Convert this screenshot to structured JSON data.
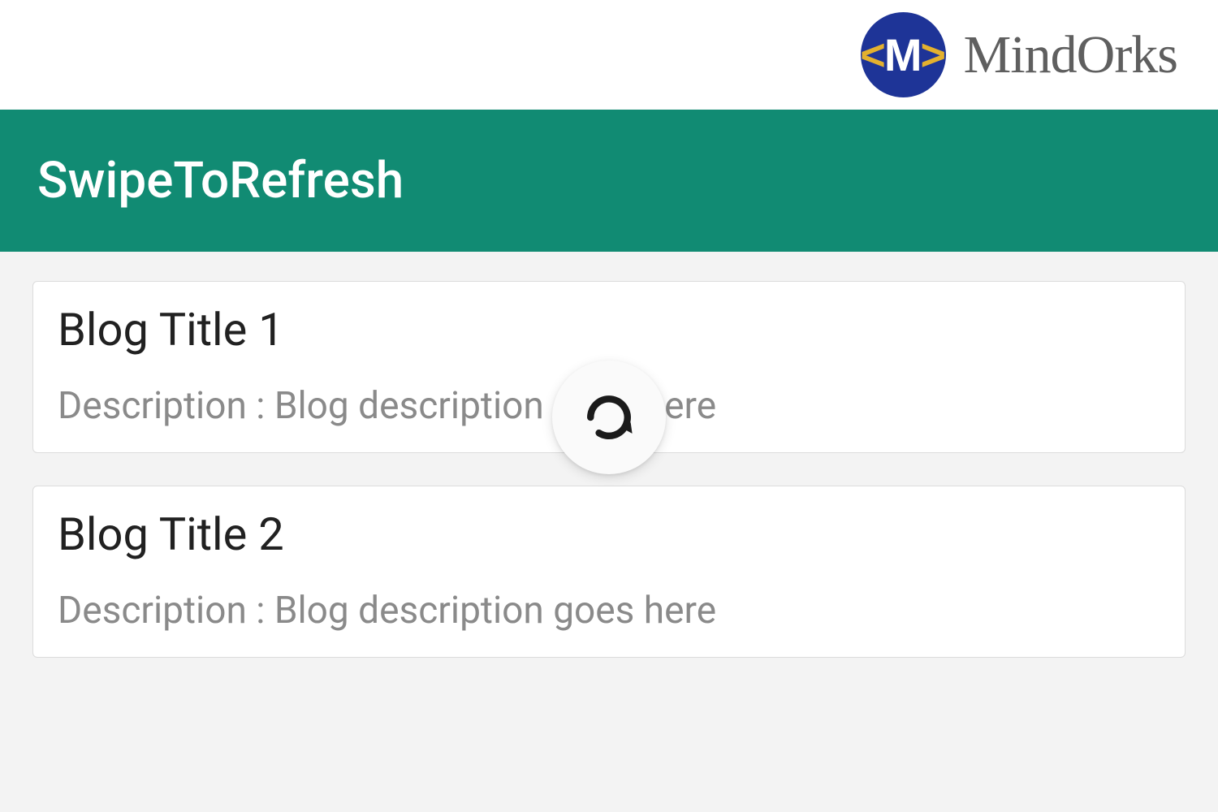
{
  "branding": {
    "name": "MindOrks",
    "logo_letter": "M"
  },
  "appbar": {
    "title": "SwipeToRefresh"
  },
  "list": {
    "items": [
      {
        "title": "Blog Title 1",
        "description": "Description : Blog description goes here"
      },
      {
        "title": "Blog Title 2",
        "description": "Description : Blog description goes here"
      }
    ]
  },
  "refresh": {
    "icon_name": "refresh-icon",
    "visible": true
  },
  "colors": {
    "appbar_bg": "#118b73",
    "brand_logo_bg": "#1e3497",
    "brand_accent": "#e4b12e",
    "text_primary": "#212121",
    "text_secondary": "#8a8a8a"
  }
}
